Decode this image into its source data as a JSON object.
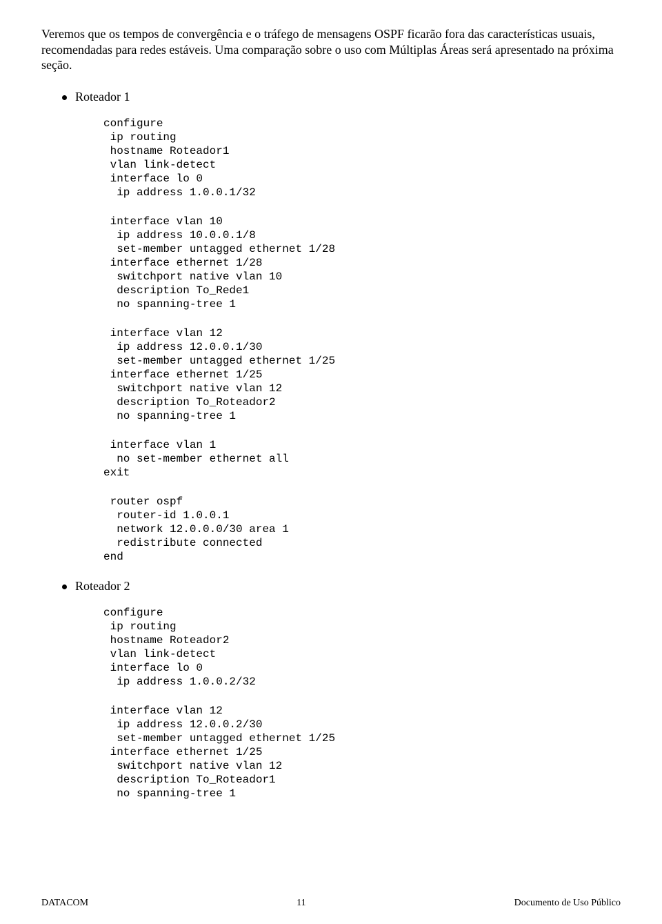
{
  "intro": "Veremos que os tempos de convergência e o tráfego de mensagens OSPF ficarão fora das características usuais, recomendadas para redes estáveis. Uma comparação sobre o uso com Múltiplas Áreas será apresentado na próxima seção.",
  "sections": {
    "r1": {
      "label": "Roteador 1",
      "code1": "configure\n ip routing\n hostname Roteador1\n vlan link-detect\n interface lo 0\n  ip address 1.0.0.1/32",
      "code2": " interface vlan 10\n  ip address 10.0.0.1/8\n  set-member untagged ethernet 1/28\n interface ethernet 1/28\n  switchport native vlan 10\n  description To_Rede1\n  no spanning-tree 1",
      "code3": " interface vlan 12\n  ip address 12.0.0.1/30\n  set-member untagged ethernet 1/25\n interface ethernet 1/25\n  switchport native vlan 12\n  description To_Roteador2\n  no spanning-tree 1",
      "code4": " interface vlan 1\n  no set-member ethernet all\nexit",
      "code5": " router ospf\n  router-id 1.0.0.1\n  network 12.0.0.0/30 area 1\n  redistribute connected\nend"
    },
    "r2": {
      "label": "Roteador 2",
      "code1": "configure\n ip routing\n hostname Roteador2\n vlan link-detect\n interface lo 0\n  ip address 1.0.0.2/32",
      "code2": " interface vlan 12\n  ip address 12.0.0.2/30\n  set-member untagged ethernet 1/25\n interface ethernet 1/25\n  switchport native vlan 12\n  description To_Roteador1\n  no spanning-tree 1"
    }
  },
  "footer": {
    "left": "DATACOM",
    "center": "11",
    "right": "Documento de Uso Público"
  }
}
